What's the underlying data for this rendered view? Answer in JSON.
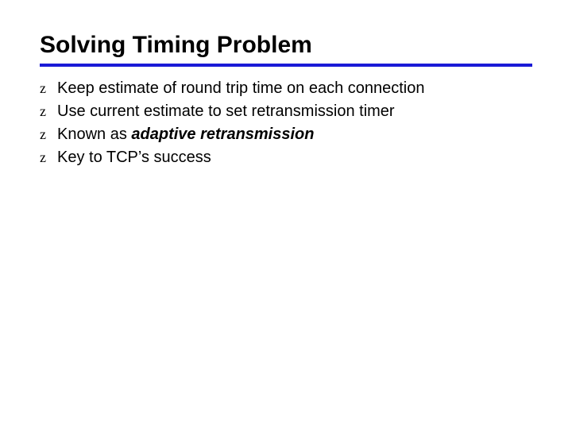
{
  "title": "Solving Timing Problem",
  "bullet_glyph": "z",
  "bullets": [
    {
      "prefix": "Keep estimate of round trip time on each connection",
      "emphasis": "",
      "suffix": ""
    },
    {
      "prefix": "Use current estimate to set retransmission timer",
      "emphasis": "",
      "suffix": ""
    },
    {
      "prefix": "Known as ",
      "emphasis": "adaptive retransmission",
      "suffix": ""
    },
    {
      "prefix": "Key to TCP’s success",
      "emphasis": "",
      "suffix": ""
    }
  ]
}
